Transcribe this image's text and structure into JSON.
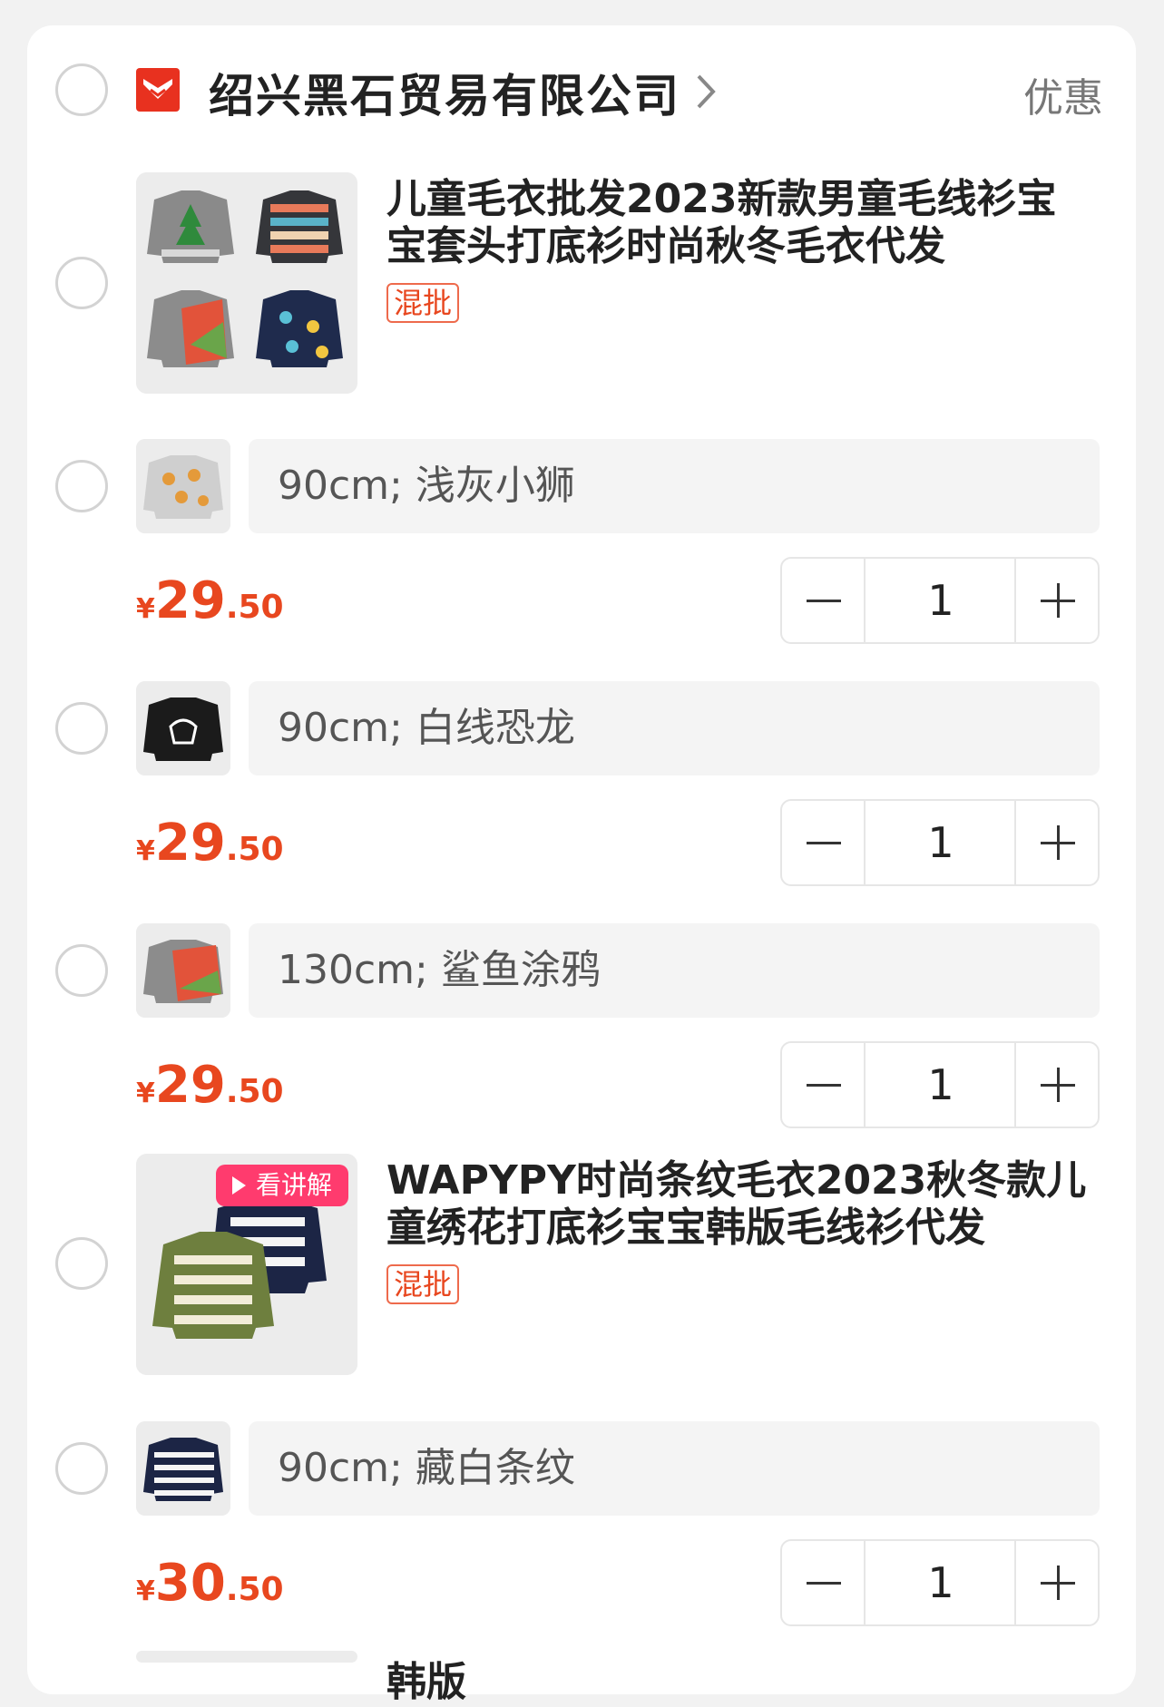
{
  "shop": {
    "name": "绍兴黑石贸易有限公司",
    "promo_label": "优惠"
  },
  "products": [
    {
      "title": "儿童毛衣批发2023新款男童毛线衫宝宝套头打底衫时尚秋冬毛衣代发",
      "tag": "混批",
      "variants": [
        {
          "spec": "90cm; 浅灰小狮",
          "price_currency": "¥",
          "price_int": "29",
          "price_dec": ".50",
          "quantity": "1"
        },
        {
          "spec": "90cm; 白线恐龙",
          "price_currency": "¥",
          "price_int": "29",
          "price_dec": ".50",
          "quantity": "1"
        },
        {
          "spec": "130cm; 鲨鱼涂鸦",
          "price_currency": "¥",
          "price_int": "29",
          "price_dec": ".50",
          "quantity": "1"
        }
      ]
    },
    {
      "title": "WAPYPY时尚条纹毛衣2023秋冬款儿童绣花打底衫宝宝韩版毛线衫代发",
      "tag": "混批",
      "video_badge": "看讲解",
      "variants": [
        {
          "spec": "90cm; 藏白条纹",
          "price_currency": "¥",
          "price_int": "30",
          "price_dec": ".50",
          "quantity": "1"
        }
      ]
    }
  ],
  "next_product_partial_title": "韩版",
  "colors": {
    "accent": "#e8471f",
    "badge": "#ff3b6e",
    "logo": "#e8311f"
  }
}
